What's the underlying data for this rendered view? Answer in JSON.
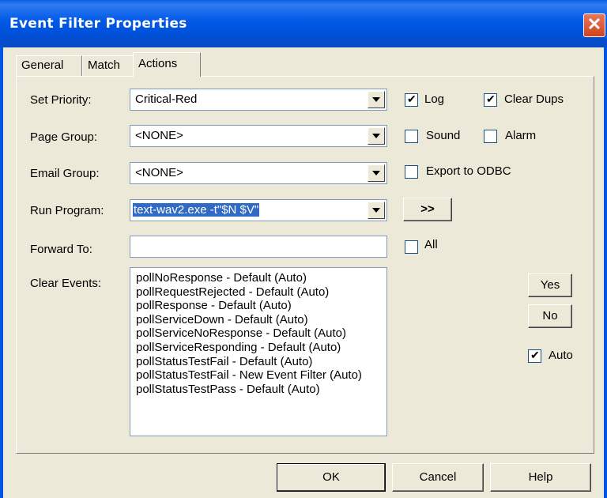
{
  "window": {
    "title": "Event Filter Properties",
    "close_glyph": "✕"
  },
  "tabs": [
    {
      "label": "General",
      "active": false
    },
    {
      "label": "Match",
      "active": false
    },
    {
      "label": "Actions",
      "active": true
    }
  ],
  "fields": {
    "set_priority": {
      "label": "Set Priority:",
      "value": "Critical-Red"
    },
    "page_group": {
      "label": "Page Group:",
      "value": "<NONE>"
    },
    "email_group": {
      "label": "Email Group:",
      "value": "<NONE>"
    },
    "run_program": {
      "label": "Run Program:",
      "value": "text-wav2.exe -t\"$N $V\"",
      "browse_label": ">>"
    },
    "forward_to": {
      "label": "Forward To:",
      "value": ""
    },
    "clear_events": {
      "label": "Clear Events:"
    }
  },
  "checkboxes": {
    "log": {
      "label": "Log",
      "checked": true
    },
    "clear_dups": {
      "label": "Clear Dups",
      "checked": true
    },
    "sound": {
      "label": "Sound",
      "checked": false
    },
    "alarm": {
      "label": "Alarm",
      "checked": false
    },
    "export_odbc": {
      "label": "Export to ODBC",
      "checked": false
    },
    "all": {
      "label": "All",
      "checked": false
    },
    "auto": {
      "label": "Auto",
      "checked": true
    }
  },
  "clear_events_list": [
    "pollNoResponse - Default (Auto)",
    "pollRequestRejected - Default (Auto)",
    "pollResponse - Default (Auto)",
    "pollServiceDown - Default (Auto)",
    "pollServiceNoResponse - Default (Auto)",
    "pollServiceResponding - Default (Auto)",
    "pollStatusTestFail - Default (Auto)",
    "pollStatusTestFail - New Event Filter (Auto)",
    "pollStatusTestPass - Default (Auto)"
  ],
  "side_buttons": {
    "yes": "Yes",
    "no": "No"
  },
  "footer": {
    "ok": "OK",
    "cancel": "Cancel",
    "help": "Help"
  }
}
